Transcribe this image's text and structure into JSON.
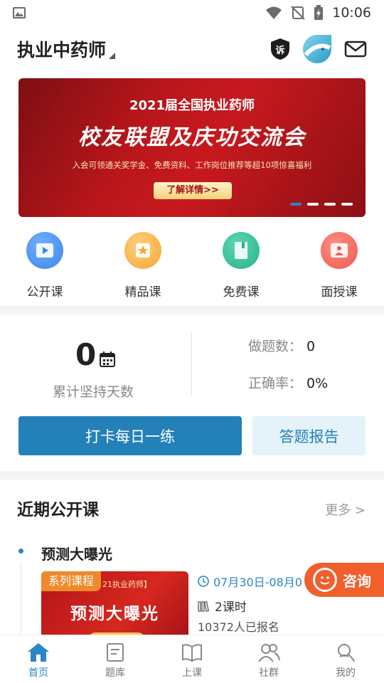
{
  "status_bar": {
    "time": "10:06"
  },
  "header": {
    "title": "执业中药师",
    "complaint_badge": "诉"
  },
  "banner": {
    "line1": "2021届全国执业药师",
    "line2": "校友联盟及庆功交流会",
    "line3": "入会可领通关奖学金、免费资料、工作岗位推荐等超10项惊喜福利",
    "cta": "了解详情>>",
    "indicator_count": 4,
    "active_index": 0
  },
  "categories": [
    {
      "label": "公开课",
      "color": "#3d86e8",
      "icon": "play-icon"
    },
    {
      "label": "精品课",
      "color": "#f2a637",
      "icon": "star-icon"
    },
    {
      "label": "免费课",
      "color": "#24b38a",
      "icon": "book-icon"
    },
    {
      "label": "面授课",
      "color": "#ee5a4f",
      "icon": "teacher-icon"
    }
  ],
  "stats": {
    "days_value": "0",
    "days_label": "累计坚持天数",
    "questions_label": "做题数：",
    "questions_value": "0",
    "accuracy_label": "正确率：",
    "accuracy_value": "0%"
  },
  "actions": {
    "checkin": "打卡每日一练",
    "report": "答题报告"
  },
  "recent": {
    "title": "近期公开课",
    "more": "更多 >",
    "course": {
      "name": "预测大曝光",
      "tag": "系列课程",
      "thumb_small": "21执业药师】",
      "thumb_title": "预测大曝光",
      "date": "07月30日-08月0",
      "lessons": "2课时",
      "signups": "10372人已报名"
    }
  },
  "consult": {
    "label": "咨询"
  },
  "tabs": [
    {
      "label": "首页",
      "icon": "home-icon"
    },
    {
      "label": "题库",
      "icon": "question-bank-icon"
    },
    {
      "label": "上课",
      "icon": "open-book-icon"
    },
    {
      "label": "社群",
      "icon": "community-icon"
    },
    {
      "label": "我的",
      "icon": "profile-icon"
    }
  ],
  "colors": {
    "accent": "#2480b8",
    "consult": "#f25e2c",
    "tag": "#ef8a2a"
  }
}
